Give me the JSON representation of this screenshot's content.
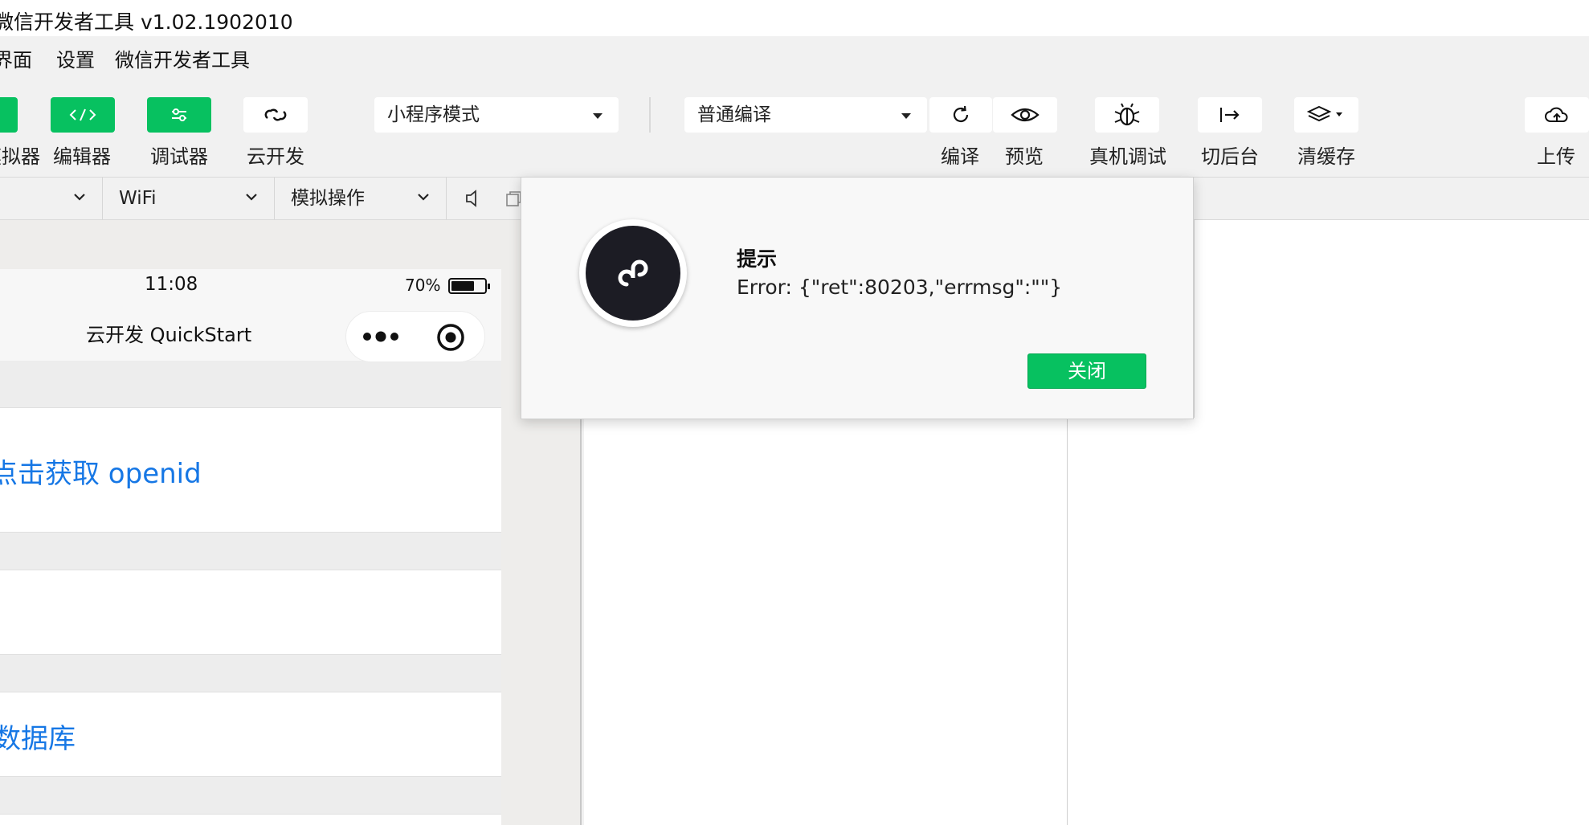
{
  "window": {
    "title": "微信开发者工具 v1.02.1902010"
  },
  "menu": {
    "items": [
      "界面",
      "设置",
      "微信开发者工具"
    ]
  },
  "toolbar": {
    "simulator_label": "模拟器",
    "editor_label": "编辑器",
    "debugger_label": "调试器",
    "cloud_label": "云开发",
    "mode_select": "小程序模式",
    "compile_select": "普通编译",
    "compile_label": "编译",
    "preview_label": "预览",
    "remote_debug_label": "真机调试",
    "background_label": "切后台",
    "clear_cache_label": "清缓存",
    "upload_label": "上传"
  },
  "subbar": {
    "network": "WiFi",
    "sim_ops": "模拟操作"
  },
  "phone": {
    "time": "11:08",
    "battery": "70%",
    "battery_level": 0.7,
    "nav_title": "云开发 QuickStart",
    "link_openid": "点击获取 openid",
    "link_db": "数据库"
  },
  "dialog": {
    "title": "提示",
    "message": "Error: {\"ret\":80203,\"errmsg\":\"\"}",
    "close_label": "关闭"
  },
  "colors": {
    "accent_green": "#07c160",
    "link_blue": "#1677e5"
  }
}
